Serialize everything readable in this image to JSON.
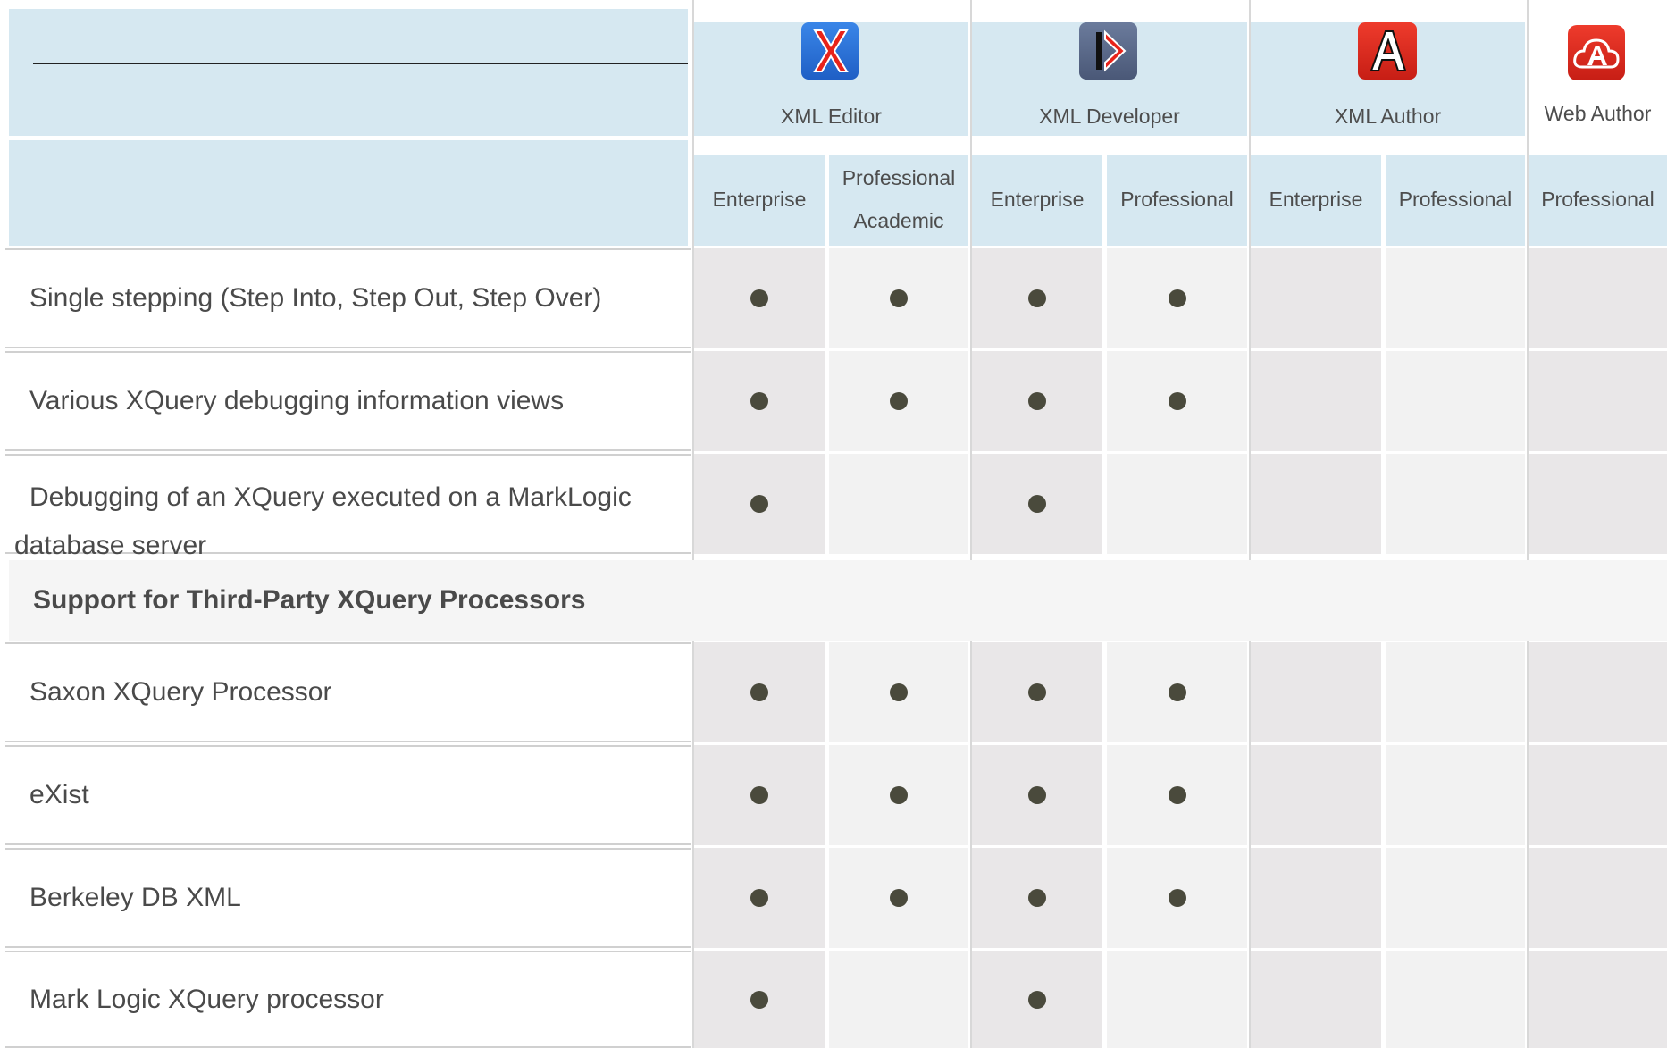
{
  "products": [
    {
      "name": "XML Editor",
      "icon": "xml-editor-icon",
      "color": "#2a6fd6"
    },
    {
      "name": "XML Developer",
      "icon": "xml-developer-icon",
      "color": "#5b6c8f"
    },
    {
      "name": "XML Author",
      "icon": "xml-author-icon",
      "color": "#d8291f"
    },
    {
      "name": "Web Author",
      "icon": "web-author-icon",
      "color": "#d8291f"
    }
  ],
  "editions": [
    "Enterprise",
    "Professional",
    "Academic",
    "Enterprise",
    "Professional",
    "Enterprise",
    "Professional",
    "Professional"
  ],
  "rows": [
    {
      "label": "Single stepping (Step Into, Step Out, Step Over)",
      "marks": [
        1,
        1,
        1,
        1,
        0,
        0,
        0
      ]
    },
    {
      "label": "Various XQuery debugging information views",
      "marks": [
        1,
        1,
        1,
        1,
        0,
        0,
        0
      ]
    },
    {
      "label": "Debugging of an XQuery executed on a MarkLogic database server",
      "marks": [
        1,
        0,
        1,
        0,
        0,
        0,
        0
      ]
    },
    {
      "label": "Saxon XQuery Processor",
      "marks": [
        1,
        1,
        1,
        1,
        0,
        0,
        0
      ]
    },
    {
      "label": "eXist",
      "marks": [
        1,
        1,
        1,
        1,
        0,
        0,
        0
      ]
    },
    {
      "label": "Berkeley DB XML",
      "marks": [
        1,
        1,
        1,
        1,
        0,
        0,
        0
      ]
    },
    {
      "label": "Mark Logic XQuery processor",
      "marks": [
        1,
        0,
        1,
        0,
        0,
        0,
        0
      ]
    }
  ],
  "section": {
    "title": "Support for Third-Party XQuery Processors"
  }
}
